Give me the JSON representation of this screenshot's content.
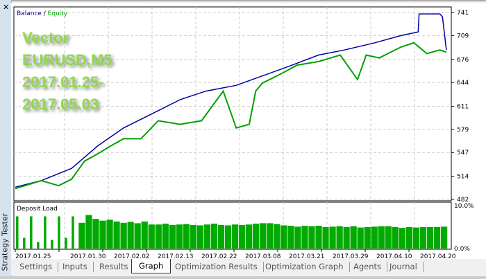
{
  "panel_title": "Strategy Tester",
  "watermark": [
    "Vector",
    "EURUSD,M5",
    "2017.01.25-",
    "2017.05.03"
  ],
  "tabs": [
    "Settings",
    "Inputs",
    "Results",
    "Graph",
    "Optimization Results",
    "Optimization Graph",
    "Agents",
    "Journal"
  ],
  "active_tab": "Graph",
  "chart_data": [
    {
      "type": "line",
      "title_balance": "Balance",
      "title_sep": " / ",
      "title_equity": "Equity",
      "colors": {
        "balance": "#0000a0",
        "equity": "#00a000"
      },
      "yticks": [
        741,
        709,
        676,
        644,
        611,
        579,
        547,
        514,
        482
      ],
      "ylim": [
        482,
        741
      ],
      "xlim": [
        0,
        100
      ],
      "series": [
        {
          "name": "Balance",
          "x": [
            0,
            6,
            13,
            19,
            25,
            32,
            38,
            44,
            51,
            57,
            63,
            70,
            76,
            83,
            89,
            93,
            93.2,
            98,
            98.6,
            99.5
          ],
          "y": [
            499,
            508,
            525,
            556,
            581,
            602,
            620,
            632,
            640,
            653,
            666,
            682,
            689,
            699,
            709,
            714,
            739,
            739,
            735,
            689
          ]
        },
        {
          "name": "Equity",
          "x": [
            0,
            6,
            10,
            13,
            16,
            19,
            22,
            25,
            29,
            33,
            38,
            43,
            48,
            51,
            54,
            55.5,
            57,
            62,
            65,
            70,
            75,
            79,
            81,
            84,
            89,
            92,
            95,
            98,
            99.5
          ],
          "y": [
            497,
            508,
            501,
            510,
            535,
            545,
            556,
            566,
            566,
            591,
            586,
            591,
            632,
            581,
            586,
            632,
            643,
            658,
            668,
            673,
            682,
            648,
            682,
            678,
            693,
            699,
            684,
            689,
            686
          ]
        }
      ]
    },
    {
      "type": "bar",
      "title": "Deposit Load",
      "yticks": [
        "10.0%",
        "0.0%"
      ],
      "ylim": [
        0,
        10
      ],
      "color": "#00aa00",
      "xticks": [
        "2017.01.25",
        "2017.01.30",
        "2017.02.02",
        "2017.02.13",
        "2017.02.22",
        "2017.03.08",
        "2017.03.21",
        "2017.03.29",
        "2017.04.10",
        "2017.04.20"
      ],
      "values": [
        7.5,
        2.5,
        7.5,
        1.5,
        7.5,
        2,
        7.5,
        2.5,
        7.5,
        6,
        7.8,
        6.9,
        6.5,
        6.7,
        6.3,
        6,
        6.2,
        5.9,
        6.3,
        5.6,
        5.6,
        5.8,
        5.5,
        5.6,
        5.7,
        5.5,
        5.4,
        5.6,
        5.8,
        5.5,
        5.4,
        5.6,
        5.5,
        5.6,
        5.8,
        5.9,
        5.9,
        5.7,
        5.4,
        5.3,
        5.1,
        5.3,
        5.2,
        5.3,
        5.0,
        5.1,
        5.2,
        5.0,
        5.2,
        4.9,
        5.0,
        5.1,
        5.2,
        5.2,
        5.0,
        4.8,
        5.0,
        4.9,
        5.0,
        5.0,
        5.0,
        5.1
      ]
    }
  ]
}
